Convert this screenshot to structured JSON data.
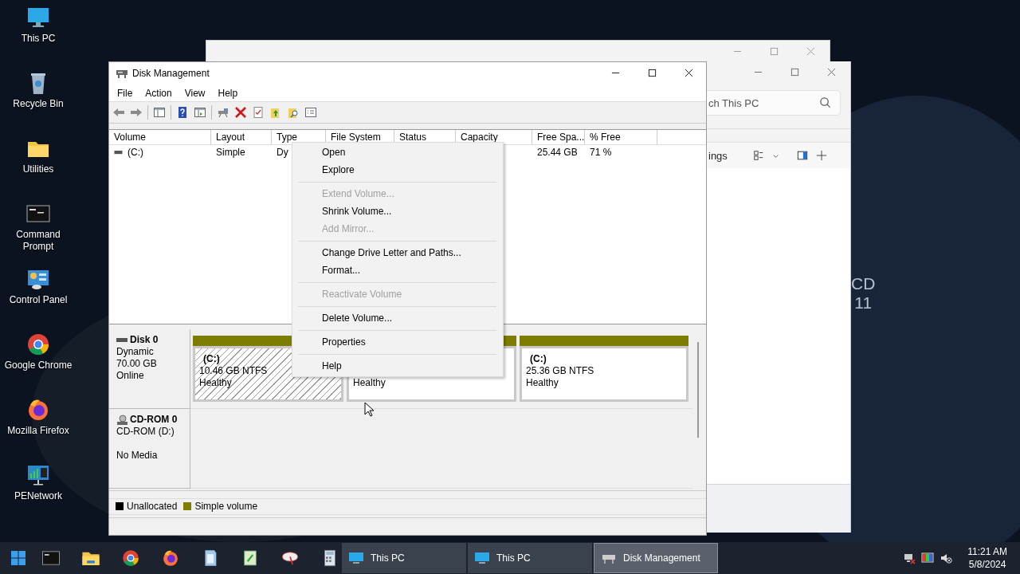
{
  "desktop": {
    "wallpaper_text": [
      "CD",
      "11"
    ],
    "icons": [
      {
        "label": "This PC",
        "kind": "monitor"
      },
      {
        "label": "Recycle Bin",
        "kind": "recycle"
      },
      {
        "label": "Utilities",
        "kind": "folder"
      },
      {
        "label": "Command Prompt",
        "kind": "terminal"
      },
      {
        "label": "Control Panel",
        "kind": "control"
      },
      {
        "label": "Google Chrome",
        "kind": "chrome"
      },
      {
        "label": "Mozilla Firefox",
        "kind": "firefox"
      },
      {
        "label": "PENetwork",
        "kind": "network"
      }
    ]
  },
  "this_pc_window": {
    "search": {
      "placeholder": "ch This PC"
    },
    "toolbar_label": "ings"
  },
  "disk_management": {
    "title": "Disk Management",
    "menu": [
      "File",
      "Action",
      "View",
      "Help"
    ],
    "columns": [
      "Volume",
      "Layout",
      "Type",
      "File System",
      "Status",
      "Capacity",
      "Free Spa...",
      "% Free"
    ],
    "rows": [
      {
        "volume": "(C:)",
        "layout": "Simple",
        "type": "Dy",
        "free_space": "25.44 GB",
        "percent_free": "71 %"
      }
    ],
    "disks": [
      {
        "name": "Disk 0",
        "kind": "disk",
        "type": "Dynamic",
        "size": "70.00 GB",
        "status": "Online",
        "partitions": [
          {
            "label": "(C:)",
            "size": "10.46 GB NTFS",
            "status": "Healthy",
            "selected": true
          },
          {
            "status": "Healthy",
            "selected": false
          },
          {
            "label": "(C:)",
            "size": "25.36 GB NTFS",
            "status": "Healthy",
            "selected": false
          }
        ]
      },
      {
        "name": "CD-ROM 0",
        "kind": "cdrom",
        "type": "CD-ROM (D:)",
        "status": "No Media"
      }
    ],
    "legend": [
      {
        "label": "Unallocated",
        "color": "#000000"
      },
      {
        "label": "Simple volume",
        "color": "#7d7d00"
      }
    ],
    "context_menu": [
      {
        "kind": "item",
        "label": "Open",
        "disabled": false
      },
      {
        "kind": "item",
        "label": "Explore",
        "disabled": false
      },
      {
        "kind": "separator"
      },
      {
        "kind": "item",
        "label": "Extend Volume...",
        "disabled": true
      },
      {
        "kind": "item",
        "label": "Shrink Volume...",
        "disabled": false
      },
      {
        "kind": "item",
        "label": "Add Mirror...",
        "disabled": true
      },
      {
        "kind": "separator"
      },
      {
        "kind": "item",
        "label": "Change Drive Letter and Paths...",
        "disabled": false
      },
      {
        "kind": "item",
        "label": "Format...",
        "disabled": false
      },
      {
        "kind": "separator"
      },
      {
        "kind": "item",
        "label": "Reactivate Volume",
        "disabled": true
      },
      {
        "kind": "separator"
      },
      {
        "kind": "item",
        "label": "Delete Volume...",
        "disabled": false
      },
      {
        "kind": "separator"
      },
      {
        "kind": "item",
        "label": "Properties",
        "disabled": false
      },
      {
        "kind": "separator"
      },
      {
        "kind": "item",
        "label": "Help",
        "disabled": false
      }
    ]
  },
  "taskbar": {
    "tasks": [
      {
        "label": "This PC",
        "kind": "explorer",
        "selected": false
      },
      {
        "label": "This PC",
        "kind": "explorer",
        "selected": false
      },
      {
        "label": "Disk Management",
        "kind": "disk",
        "selected": true
      }
    ],
    "time": "11:21 AM",
    "date": "5/8/2024"
  }
}
